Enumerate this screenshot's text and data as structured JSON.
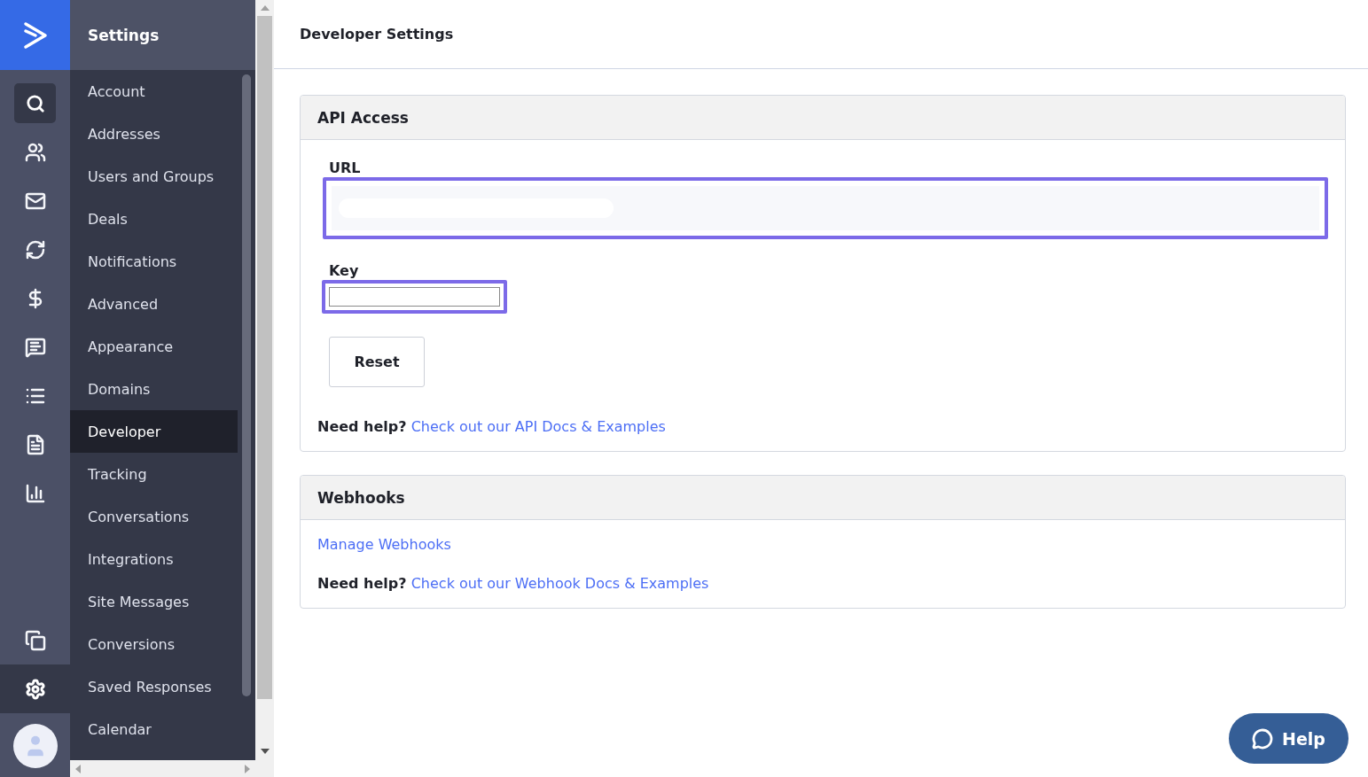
{
  "rail": {
    "items": [
      {
        "kind": "search",
        "selected": false
      },
      {
        "kind": "contacts",
        "selected": false
      },
      {
        "kind": "mail",
        "selected": false
      },
      {
        "kind": "automation",
        "selected": false
      },
      {
        "kind": "dollar",
        "selected": false
      },
      {
        "kind": "chat",
        "selected": false
      },
      {
        "kind": "list",
        "selected": false
      },
      {
        "kind": "form",
        "selected": false
      },
      {
        "kind": "chart",
        "selected": false
      },
      {
        "kind": "windows",
        "selected": false
      },
      {
        "kind": "settings",
        "selected": true
      }
    ]
  },
  "settings_menu": {
    "title": "Settings",
    "items": [
      {
        "label": "Account",
        "selected": false
      },
      {
        "label": "Addresses",
        "selected": false
      },
      {
        "label": "Users and Groups",
        "selected": false
      },
      {
        "label": "Deals",
        "selected": false
      },
      {
        "label": "Notifications",
        "selected": false
      },
      {
        "label": "Advanced",
        "selected": false
      },
      {
        "label": "Appearance",
        "selected": false
      },
      {
        "label": "Domains",
        "selected": false
      },
      {
        "label": "Developer",
        "selected": true
      },
      {
        "label": "Tracking",
        "selected": false
      },
      {
        "label": "Conversations",
        "selected": false
      },
      {
        "label": "Integrations",
        "selected": false
      },
      {
        "label": "Site Messages",
        "selected": false
      },
      {
        "label": "Conversions",
        "selected": false
      },
      {
        "label": "Saved Responses",
        "selected": false
      },
      {
        "label": "Calendar",
        "selected": false
      }
    ]
  },
  "page": {
    "title": "Developer Settings"
  },
  "api_access": {
    "title": "API Access",
    "fields": [
      {
        "label": "URL",
        "kind": "wide",
        "highlighted": true
      },
      {
        "label": "Key",
        "kind": "short",
        "highlighted": true
      }
    ],
    "button": "Reset",
    "help_prefix": "Need help?",
    "help_link": "Check out our API Docs & Examples"
  },
  "webhooks": {
    "title": "Webhooks",
    "link": "Manage Webhooks",
    "help_prefix": "Need help?",
    "help_link": "Check out our Webhook Docs & Examples"
  },
  "help_button": {
    "label": "Help"
  }
}
